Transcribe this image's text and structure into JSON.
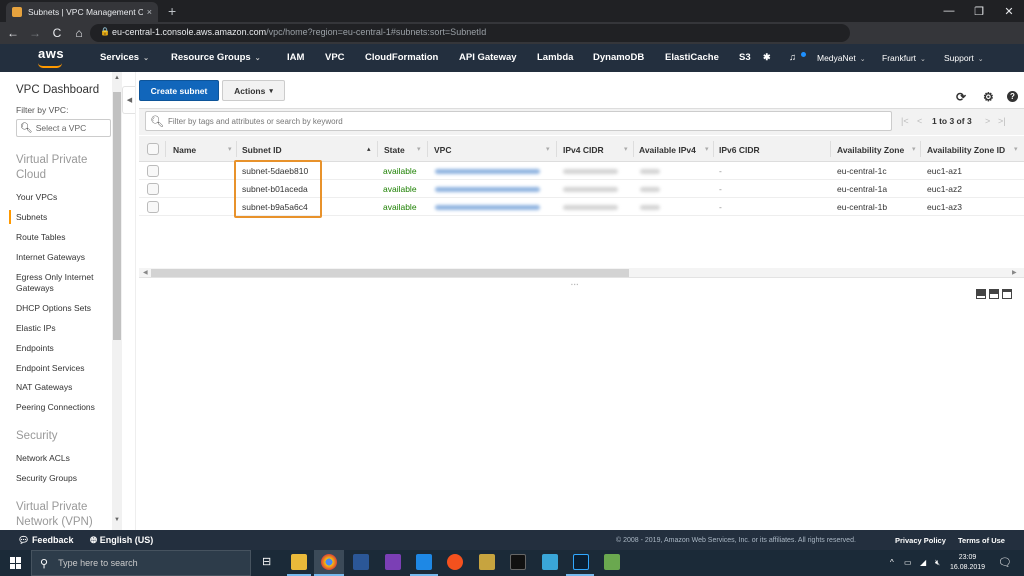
{
  "browser": {
    "tab_title": "Subnets | VPC Management Con",
    "tab_close": "×",
    "new_tab": "+",
    "window_controls": [
      "—",
      "❐",
      "✕"
    ],
    "url_host": "eu-central-1.console.aws.amazon.com",
    "url_path": "/vpc/home?region=eu-central-1#subnets:sort=SubnetId",
    "back": "←",
    "forward": "→",
    "reload": "C",
    "home": "⌂",
    "bookmark": "☆",
    "menu": "⋮"
  },
  "aws_nav": {
    "logo": "aws",
    "services": "Services",
    "resource_groups": "Resource Groups",
    "shortcuts": [
      "IAM",
      "VPC",
      "CloudFormation",
      "API Gateway",
      "Lambda",
      "DynamoDB",
      "ElastiCache",
      "S3"
    ],
    "pin": "📌",
    "bell": "🔔",
    "account": "MedyaNet",
    "region": "Frankfurt",
    "support": "Support",
    "caret": "⌄"
  },
  "sidebar": {
    "title": "VPC Dashboard",
    "filter_label": "Filter by VPC:",
    "filter_placeholder": "Select a VPC",
    "sections": [
      {
        "title": "Virtual Private Cloud",
        "items": [
          "Your VPCs",
          "Subnets",
          "Route Tables",
          "Internet Gateways",
          "Egress Only Internet Gateways",
          "DHCP Options Sets",
          "Elastic IPs",
          "Endpoints",
          "Endpoint Services",
          "NAT Gateways",
          "Peering Connections"
        ]
      },
      {
        "title": "Security",
        "items": [
          "Network ACLs",
          "Security Groups"
        ]
      },
      {
        "title": "Virtual Private Network (VPN)",
        "items": []
      }
    ],
    "active_item": "Subnets"
  },
  "toolbar": {
    "create_label": "Create subnet",
    "actions_label": "Actions",
    "filter_placeholder": "Filter by tags and attributes or search by keyword",
    "pager_text": "1 to 3 of 3",
    "pager_first": "|<",
    "pager_prev": "<",
    "pager_next": ">",
    "pager_last": ">|",
    "refresh": "⟳",
    "settings": "⚙",
    "help": "?"
  },
  "table": {
    "columns": [
      "Name",
      "Subnet ID",
      "State",
      "VPC",
      "IPv4 CIDR",
      "Available IPv4",
      "IPv6 CIDR",
      "Availability Zone",
      "Availability Zone ID"
    ],
    "sorted_column": "Subnet ID",
    "rows": [
      {
        "name": "",
        "subnet_id": "subnet-5daeb810",
        "state": "available",
        "vpc": "[redacted]",
        "ipv4_cidr": "[redacted]",
        "available_ipv4": "[redacted]",
        "ipv6_cidr": "-",
        "az": "eu-central-1c",
        "az_id": "euc1-az1"
      },
      {
        "name": "",
        "subnet_id": "subnet-b01aceda",
        "state": "available",
        "vpc": "[redacted]",
        "ipv4_cidr": "[redacted]",
        "available_ipv4": "[redacted]",
        "ipv6_cidr": "-",
        "az": "eu-central-1a",
        "az_id": "euc1-az2"
      },
      {
        "name": "",
        "subnet_id": "subnet-b9a5a6c4",
        "state": "available",
        "vpc": "[redacted]",
        "ipv4_cidr": "[redacted]",
        "available_ipv4": "[redacted]",
        "ipv6_cidr": "-",
        "az": "eu-central-1b",
        "az_id": "euc1-az3"
      }
    ]
  },
  "footer": {
    "feedback": "Feedback",
    "language": "English (US)",
    "copyright": "© 2008 - 2019, Amazon Web Services, Inc. or its affiliates. All rights reserved.",
    "privacy": "Privacy Policy",
    "terms": "Terms of Use"
  },
  "taskbar": {
    "search_placeholder": "Type here to search",
    "time": "23:09",
    "date": "16.08.2019",
    "tray": "^"
  },
  "colors": {
    "aws_nav": "#232f3e",
    "primary_button": "#1166bb",
    "accent_orange": "#ff9900",
    "highlight": "#e8922b",
    "status_green": "#1d8102"
  }
}
